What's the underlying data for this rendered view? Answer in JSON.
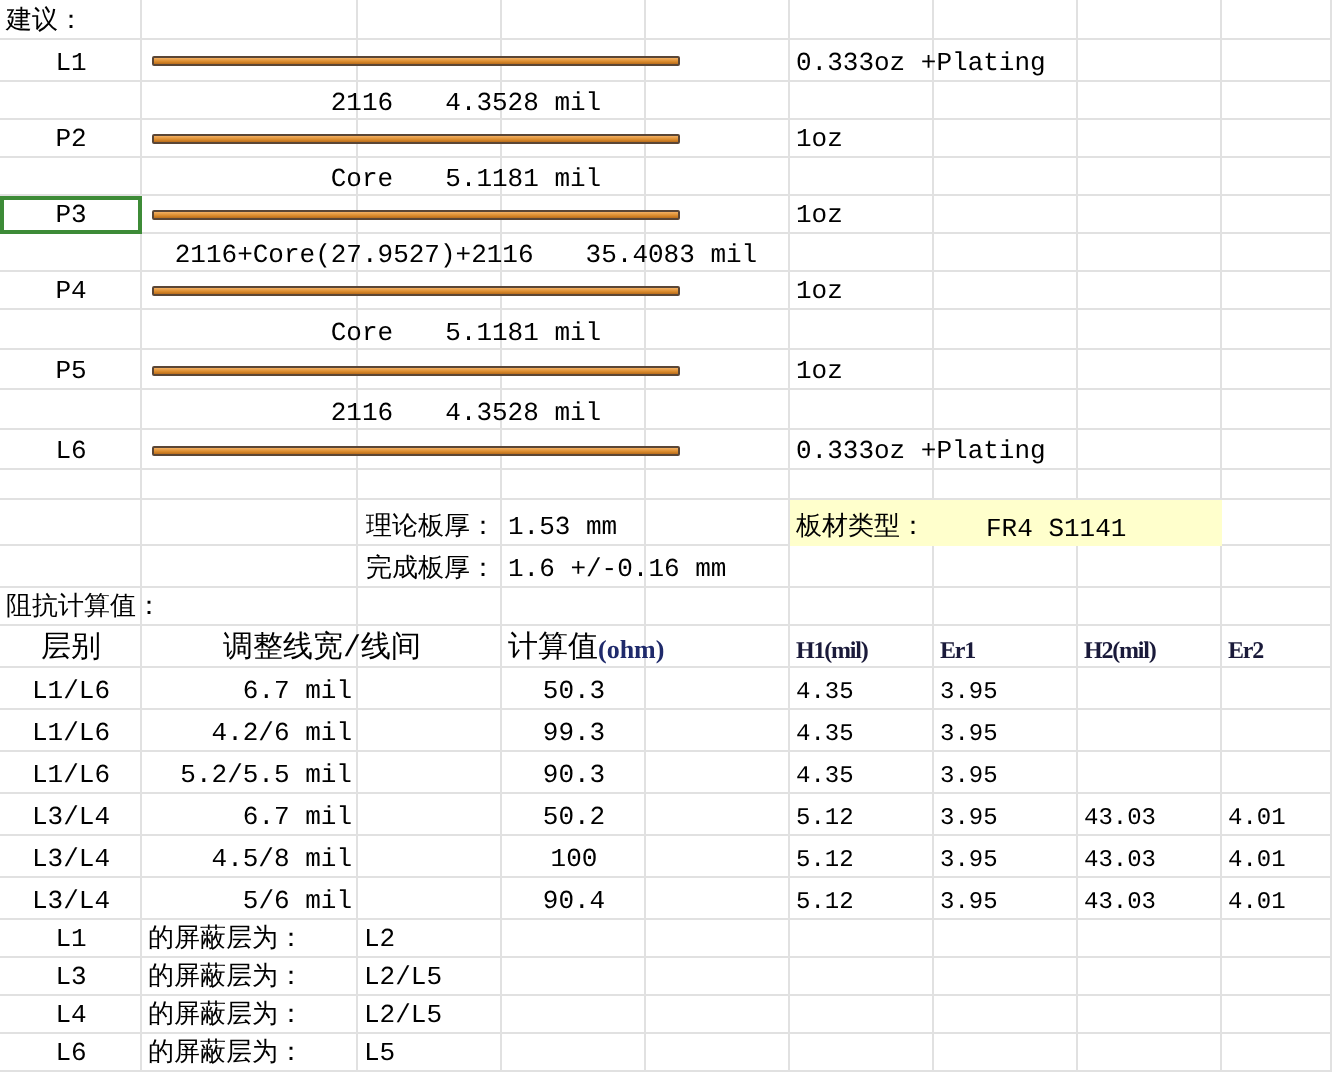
{
  "heading": "建议：",
  "stackup": [
    {
      "kind": "layer",
      "name": "L1",
      "copper": "0.333oz +Plating",
      "selected": false
    },
    {
      "kind": "dielectric",
      "material": "2116",
      "thickness": "4.3528 mil",
      "selected": false
    },
    {
      "kind": "layer",
      "name": "P2",
      "copper": "1oz",
      "selected": false
    },
    {
      "kind": "dielectric",
      "material": "Core",
      "thickness": "5.1181 mil",
      "selected": false
    },
    {
      "kind": "layer",
      "name": "P3",
      "copper": "1oz",
      "selected": true
    },
    {
      "kind": "dielectric",
      "material": "2116+Core(27.9527)+2116",
      "thickness": "35.4083 mil",
      "selected": false
    },
    {
      "kind": "layer",
      "name": "P4",
      "copper": "1oz",
      "selected": false
    },
    {
      "kind": "dielectric",
      "material": "Core",
      "thickness": "5.1181 mil",
      "selected": false
    },
    {
      "kind": "layer",
      "name": "P5",
      "copper": "1oz",
      "selected": false
    },
    {
      "kind": "dielectric",
      "material": "2116",
      "thickness": "4.3528 mil",
      "selected": false
    },
    {
      "kind": "layer",
      "name": "L6",
      "copper": "0.333oz +Plating",
      "selected": false
    }
  ],
  "board": {
    "theory_label": "理论板厚：",
    "theory_value": "1.53 mm",
    "finished_label": "完成板厚：",
    "finished_value": "1.6 +/-0.16 mm",
    "material_label": "板材类型：",
    "material_value": "FR4 S1141"
  },
  "impedance": {
    "title": "阻抗计算值：",
    "columns": [
      {
        "label": "层别",
        "kind": "cjk"
      },
      {
        "label": "调整线宽/线间",
        "kind": "cjk"
      },
      {
        "label": "计算值(ohm)",
        "kind": "cjk"
      },
      {
        "label": "H1(mil)",
        "kind": "latin"
      },
      {
        "label": "Er1",
        "kind": "latin"
      },
      {
        "label": "H2(mil)",
        "kind": "latin"
      },
      {
        "label": "Er2",
        "kind": "latin"
      }
    ],
    "rows": [
      {
        "layer": "L1/L6",
        "width": "6.7 mil",
        "value": "50.3",
        "h1": "4.35",
        "er1": "3.95"
      },
      {
        "layer": "L1/L6",
        "width": "4.2/6 mil",
        "value": "99.3",
        "h1": "4.35",
        "er1": "3.95"
      },
      {
        "layer": "L1/L6",
        "width": "5.2/5.5 mil",
        "value": "90.3",
        "h1": "4.35",
        "er1": "3.95"
      },
      {
        "layer": "L3/L4",
        "width": "6.7 mil",
        "value": "50.2",
        "h1": "5.12",
        "er1": "3.95",
        "h2": "43.03",
        "er2": "4.01"
      },
      {
        "layer": "L3/L4",
        "width": "4.5/8 mil",
        "value": "100",
        "h1": "5.12",
        "er1": "3.95",
        "h2": "43.03",
        "er2": "4.01"
      },
      {
        "layer": "L3/L4",
        "width": "5/6 mil",
        "value": "90.4",
        "h1": "5.12",
        "er1": "3.95",
        "h2": "43.03",
        "er2": "4.01"
      }
    ]
  },
  "shielding": [
    {
      "layer": "L1",
      "label": "的屏蔽层为：",
      "ref": "L2"
    },
    {
      "layer": "L3",
      "label": "的屏蔽层为：",
      "ref": "L2/L5"
    },
    {
      "layer": "L4",
      "label": "的屏蔽层为：",
      "ref": "L2/L5"
    },
    {
      "layer": "L6",
      "label": "的屏蔽层为：",
      "ref": "L5"
    }
  ]
}
